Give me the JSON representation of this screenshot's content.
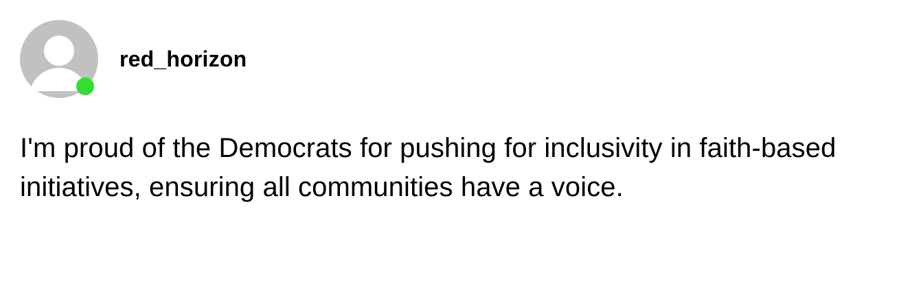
{
  "post": {
    "username": "red_horizon",
    "online_status": "online",
    "avatar_icon": "default-user-avatar-icon",
    "status_color": "#33dd33",
    "text": "I'm proud of the Democrats for pushing for inclusivity in faith-based initiatives, ensuring all communities have a voice."
  }
}
